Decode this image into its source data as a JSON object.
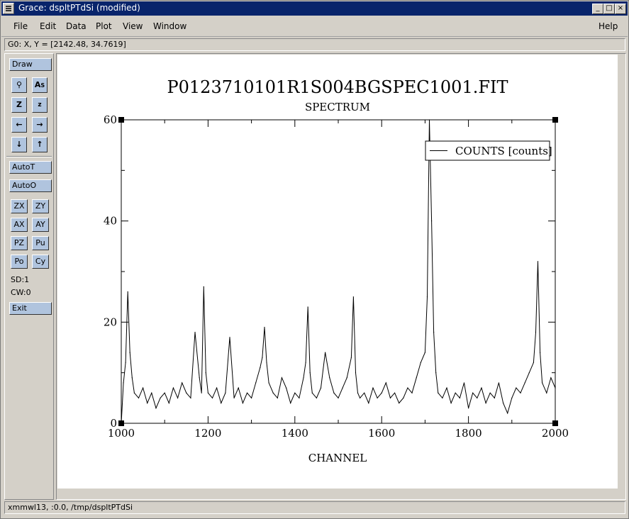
{
  "window": {
    "title": "Grace: dspltPTdSi (modified)"
  },
  "menu": {
    "file": "File",
    "edit": "Edit",
    "data": "Data",
    "plot": "Plot",
    "view": "View",
    "window": "Window",
    "help": "Help"
  },
  "coords": "G0: X, Y = [2142.48, 34.7619]",
  "toolbar": {
    "draw": "Draw",
    "autot": "AutoT",
    "autoo": "AutoO",
    "zx": "ZX",
    "zy": "ZY",
    "ax": "AX",
    "ay": "AY",
    "pz": "PZ",
    "pu": "Pu",
    "po": "Po",
    "cy": "Cy",
    "sd": "SD:1",
    "cw": "CW:0",
    "exit": "Exit",
    "icons": [
      "magnifier-icon",
      "text-size-icon",
      "zoom-in-icon",
      "zoom-out-icon",
      "arrow-left-icon",
      "arrow-right-icon",
      "arrow-down-icon",
      "arrow-up-icon"
    ]
  },
  "status": "xmmwl13, :0.0, /tmp/dspltPTdSi",
  "chart_data": {
    "type": "line",
    "title": "P0123710101R1S004BGSPEC1001.FIT",
    "subtitle": "SPECTRUM",
    "xlabel": "CHANNEL",
    "ylabel": "",
    "xlim": [
      1000,
      2000
    ],
    "ylim": [
      0,
      60
    ],
    "xticks": [
      "1000",
      "1200",
      "1400",
      "1600",
      "1800",
      "2000"
    ],
    "yticks": [
      "0",
      "20",
      "40",
      "60"
    ],
    "legend": {
      "label": "COUNTS [counts]",
      "placement": "top-right"
    },
    "series": [
      {
        "name": "COUNTS [counts]",
        "x": [
          1000,
          1005,
          1010,
          1015,
          1020,
          1025,
          1030,
          1040,
          1050,
          1060,
          1070,
          1080,
          1090,
          1100,
          1110,
          1120,
          1130,
          1140,
          1150,
          1160,
          1170,
          1180,
          1185,
          1190,
          1195,
          1200,
          1210,
          1220,
          1230,
          1240,
          1250,
          1260,
          1270,
          1280,
          1290,
          1300,
          1310,
          1320,
          1325,
          1330,
          1335,
          1340,
          1350,
          1360,
          1370,
          1380,
          1390,
          1400,
          1410,
          1420,
          1425,
          1430,
          1435,
          1440,
          1450,
          1460,
          1470,
          1480,
          1490,
          1500,
          1510,
          1520,
          1530,
          1535,
          1540,
          1545,
          1550,
          1560,
          1570,
          1580,
          1590,
          1600,
          1610,
          1620,
          1630,
          1640,
          1650,
          1660,
          1670,
          1680,
          1690,
          1700,
          1705,
          1710,
          1715,
          1720,
          1725,
          1730,
          1740,
          1750,
          1760,
          1770,
          1780,
          1790,
          1800,
          1810,
          1820,
          1830,
          1840,
          1850,
          1860,
          1870,
          1880,
          1890,
          1900,
          1910,
          1920,
          1930,
          1940,
          1950,
          1955,
          1960,
          1965,
          1970,
          1980,
          1990,
          2000
        ],
        "y": [
          0,
          8,
          12,
          26,
          14,
          9,
          6,
          5,
          7,
          4,
          6,
          3,
          5,
          6,
          4,
          7,
          5,
          8,
          6,
          5,
          18,
          9,
          6,
          27,
          10,
          6,
          5,
          7,
          4,
          6,
          17,
          5,
          7,
          4,
          6,
          5,
          8,
          11,
          13,
          19,
          12,
          8,
          6,
          5,
          9,
          7,
          4,
          6,
          5,
          9,
          12,
          23,
          10,
          6,
          5,
          7,
          14,
          9,
          6,
          5,
          7,
          9,
          13,
          25,
          10,
          6,
          5,
          6,
          4,
          7,
          5,
          6,
          8,
          5,
          6,
          4,
          5,
          7,
          6,
          9,
          12,
          14,
          25,
          60,
          40,
          18,
          10,
          6,
          5,
          7,
          4,
          6,
          5,
          8,
          3,
          6,
          5,
          7,
          4,
          6,
          5,
          8,
          4,
          2,
          5,
          7,
          6,
          8,
          10,
          12,
          18,
          32,
          14,
          8,
          6,
          9,
          7
        ]
      }
    ]
  }
}
